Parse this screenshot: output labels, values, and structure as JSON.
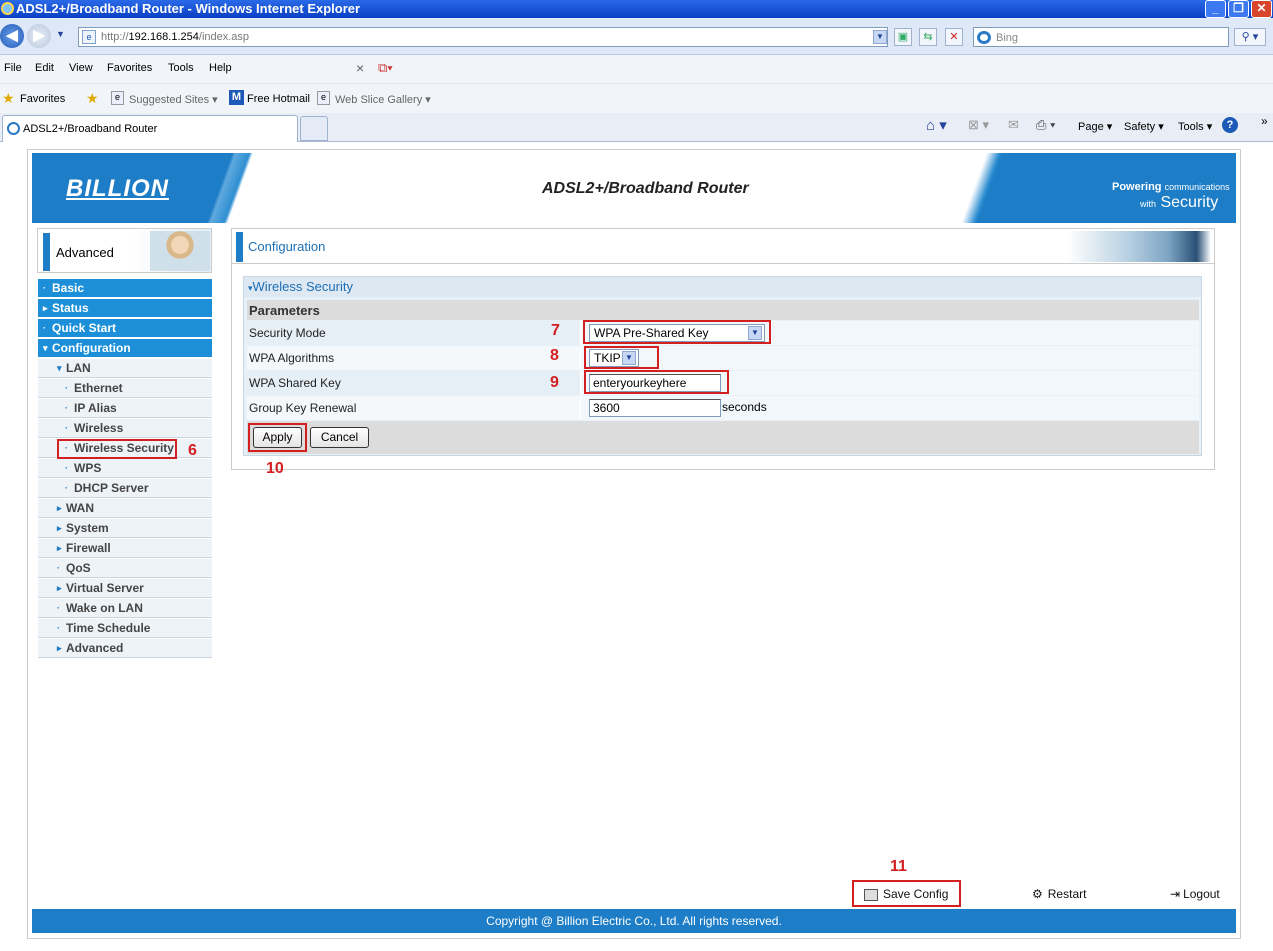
{
  "window": {
    "title": "ADSL2+/Broadband Router - Windows Internet Explorer",
    "minimize": "_",
    "restore": "❐",
    "close": "✕"
  },
  "address": {
    "url_prefix": "http://",
    "url_host": "192.168.1.254",
    "url_path": "/index.asp",
    "search_placeholder": "Bing"
  },
  "menu": [
    "File",
    "Edit",
    "View",
    "Favorites",
    "Tools",
    "Help"
  ],
  "favorites_bar": {
    "favorites": "Favorites",
    "suggested": "Suggested Sites",
    "hotmail": "Free Hotmail",
    "slice": "Web Slice Gallery"
  },
  "tab": {
    "label": "ADSL2+/Broadband Router"
  },
  "command_bar": {
    "page": "Page",
    "safety": "Safety",
    "tools": "Tools"
  },
  "banner": {
    "logo": "BILLION",
    "title": "ADSL2+/Broadband Router",
    "powering": "Powering",
    "communications": "communications",
    "with": "with",
    "security": "Security"
  },
  "sidebar": {
    "header": "Advanced",
    "items": [
      {
        "label": "Basic",
        "level": "main",
        "marker": "·"
      },
      {
        "label": "Status",
        "level": "main",
        "marker": "▸"
      },
      {
        "label": "Quick Start",
        "level": "main",
        "marker": "·"
      },
      {
        "label": "Configuration",
        "level": "main",
        "marker": "▾"
      },
      {
        "label": "LAN",
        "level": "sub1",
        "marker": "▾"
      },
      {
        "label": "Ethernet",
        "level": "sub2",
        "marker": "·"
      },
      {
        "label": "IP Alias",
        "level": "sub2",
        "marker": "·"
      },
      {
        "label": "Wireless",
        "level": "sub2",
        "marker": "·"
      },
      {
        "label": "Wireless Security",
        "level": "sub2",
        "marker": "·"
      },
      {
        "label": "WPS",
        "level": "sub2",
        "marker": "·"
      },
      {
        "label": "DHCP Server",
        "level": "sub2",
        "marker": "·"
      },
      {
        "label": "WAN",
        "level": "sub1",
        "marker": "▸"
      },
      {
        "label": "System",
        "level": "sub1",
        "marker": "▸"
      },
      {
        "label": "Firewall",
        "level": "sub1",
        "marker": "▸"
      },
      {
        "label": "QoS",
        "level": "sub1",
        "marker": "·"
      },
      {
        "label": "Virtual Server",
        "level": "sub1",
        "marker": "▸"
      },
      {
        "label": "Wake on LAN",
        "level": "sub1",
        "marker": "·"
      },
      {
        "label": "Time Schedule",
        "level": "sub1",
        "marker": "·"
      },
      {
        "label": "Advanced",
        "level": "sub1",
        "marker": "▸"
      }
    ]
  },
  "config": {
    "title": "Configuration",
    "section": "Wireless Security",
    "parameters": "Parameters",
    "security_mode_label": "Security Mode",
    "security_mode_value": "WPA Pre-Shared Key",
    "wpa_alg_label": "WPA Algorithms",
    "wpa_alg_value": "TKIP",
    "wpa_key_label": "WPA Shared Key",
    "wpa_key_value": "enteryourkeyhere",
    "group_key_label": "Group Key Renewal",
    "group_key_value": "3600",
    "group_key_unit": "seconds",
    "apply": "Apply",
    "cancel": "Cancel"
  },
  "annotations": {
    "n6": "6",
    "n7": "7",
    "n8": "8",
    "n9": "9",
    "n10": "10",
    "n11": "11"
  },
  "bottom_links": {
    "save": "Save Config",
    "restart": "Restart",
    "logout": "Logout"
  },
  "footer": "Copyright @ Billion Electric Co., Ltd. All rights reserved.",
  "colors": {
    "accent": "#1d7dc6",
    "annotation": "#d21f1f"
  }
}
